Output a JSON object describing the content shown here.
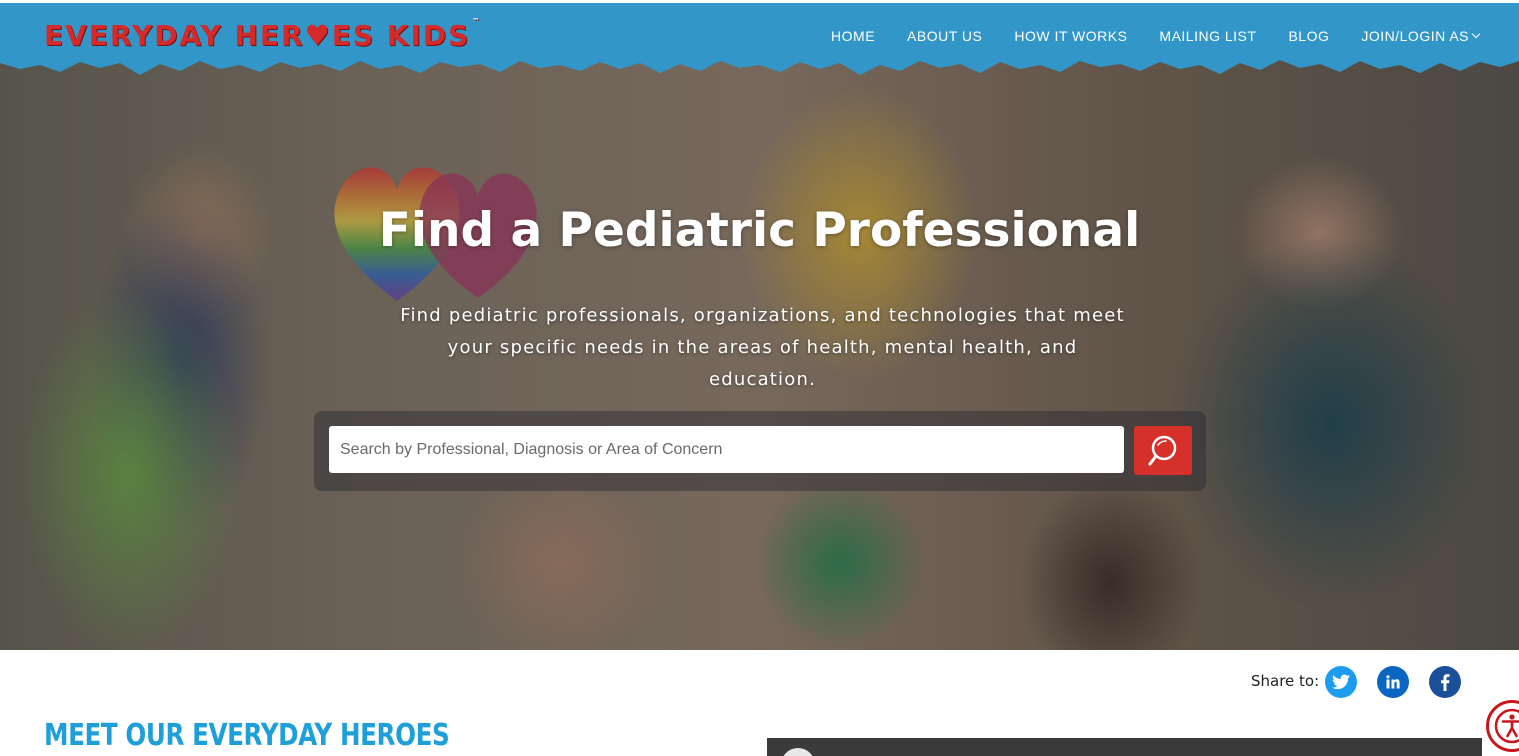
{
  "header": {
    "logo_text": "EVERYDAY HER♥ES KIDS",
    "logo_tm": "™",
    "nav": [
      {
        "label": "HOME"
      },
      {
        "label": "ABOUT US"
      },
      {
        "label": "HOW IT WORKS"
      },
      {
        "label": "MAILING LIST"
      },
      {
        "label": "BLOG"
      },
      {
        "label": "JOIN/LOGIN AS"
      }
    ]
  },
  "hero": {
    "title": "Find a Pediatric Professional",
    "subtitle": "Find pediatric professionals, organizations, and technologies that meet your specific needs in the areas of health, mental health, and education.",
    "search": {
      "placeholder": "Search by Professional, Diagnosis or Area of Concern",
      "value": ""
    }
  },
  "share": {
    "label": "Share to:",
    "networks": [
      {
        "name": "Twitter",
        "icon": "twitter-icon",
        "color": "#1d9bf0"
      },
      {
        "name": "LinkedIn",
        "icon": "linkedin-icon",
        "color": "#0a66c2"
      },
      {
        "name": "Facebook",
        "icon": "facebook-icon",
        "color": "#1b4f9a"
      }
    ]
  },
  "main": {
    "section_title": "MEET OUR EVERYDAY HEROES"
  },
  "colors": {
    "header_blue": "#3296c9",
    "logo_red": "#d42a2a",
    "search_button_red": "#d6302a",
    "section_title_blue": "#1e9fd9"
  },
  "icons": {
    "search_button": "search-icon",
    "accessibility": "accessibility-icon",
    "dropdown": "chevron-down-icon"
  }
}
